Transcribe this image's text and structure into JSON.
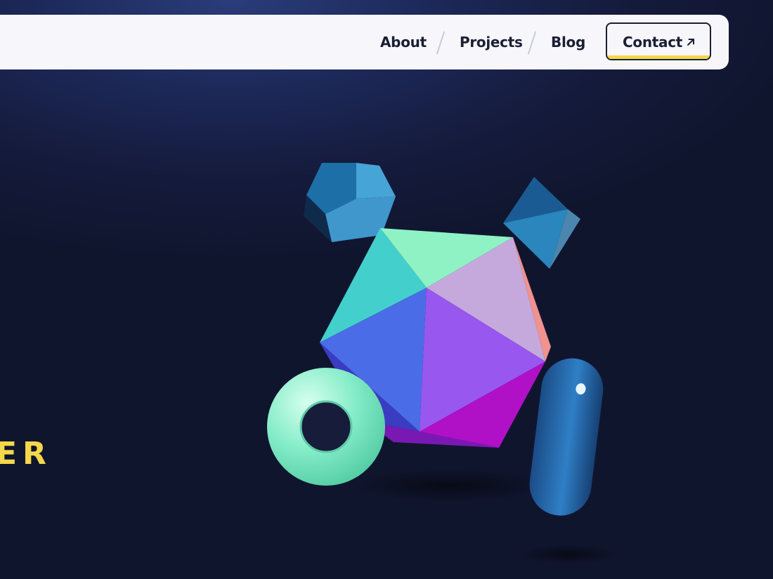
{
  "nav": {
    "links": [
      {
        "label": "About"
      },
      {
        "label": "Projects"
      },
      {
        "label": "Blog"
      }
    ],
    "contact_label": "Contact",
    "contact_icon": "arrow-up-right-icon"
  },
  "hero": {
    "text_fragment": "ER"
  },
  "colors": {
    "accent": "#f5d84a",
    "nav_bg": "#f7f7fb",
    "text_dark": "#1a1f33",
    "page_bg": "#141a3a"
  }
}
